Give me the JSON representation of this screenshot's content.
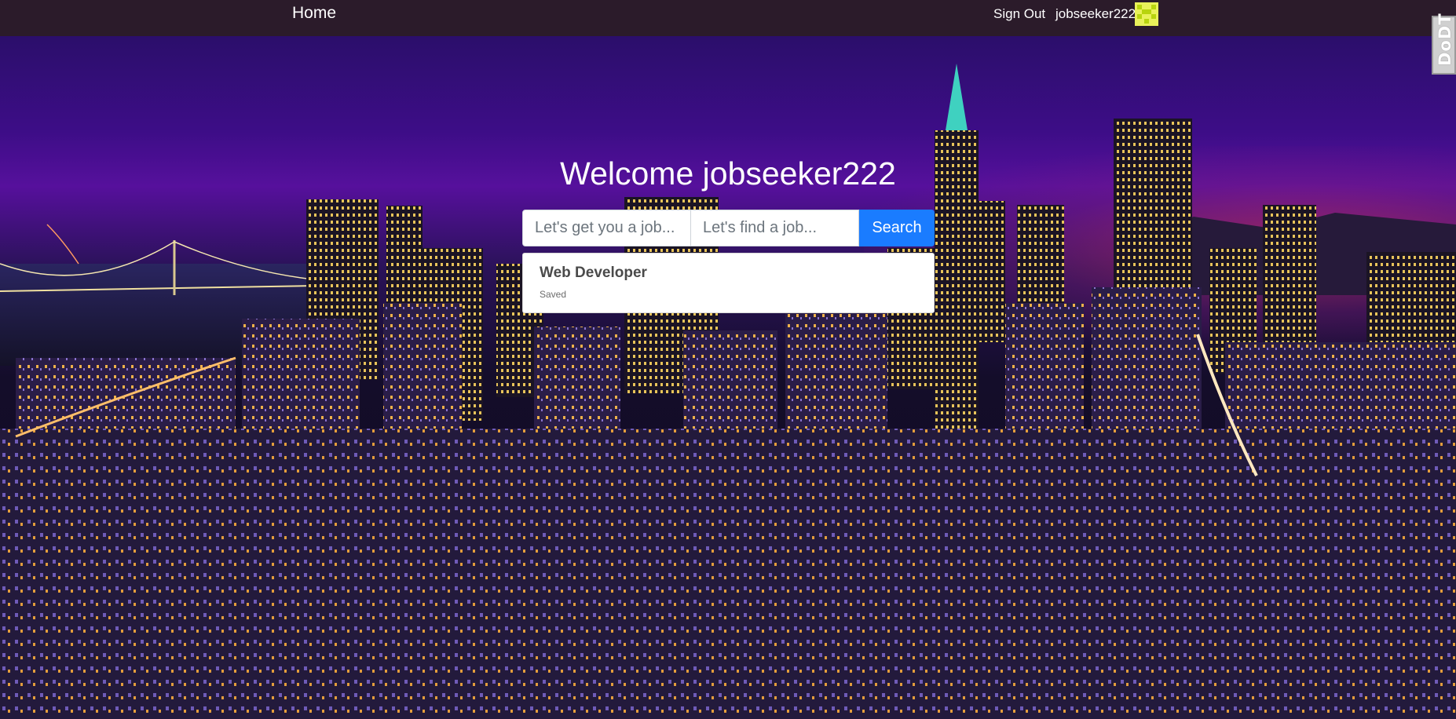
{
  "navbar": {
    "home_label": "Home",
    "signout_label": "Sign Out",
    "username": "jobseeker222",
    "avatar_icon": "identicon-avatar",
    "avatar_colors": [
      "#e9f15a",
      "#b8d40e"
    ],
    "background": "#2b1b2a"
  },
  "devtools_tab": {
    "label": "DoDT"
  },
  "hero": {
    "welcome": "Welcome jobseeker222",
    "background_description_colors": [
      "#2b0e6b",
      "#56109c",
      "#0e0a1c"
    ]
  },
  "search": {
    "what_placeholder": "Let's get you a job...",
    "where_placeholder": "Let's find a job...",
    "what_value": "",
    "where_value": "",
    "button_label": "Search",
    "button_color": "#1a7cff"
  },
  "results": [
    {
      "title": "Web Developer",
      "status": "Saved"
    }
  ]
}
